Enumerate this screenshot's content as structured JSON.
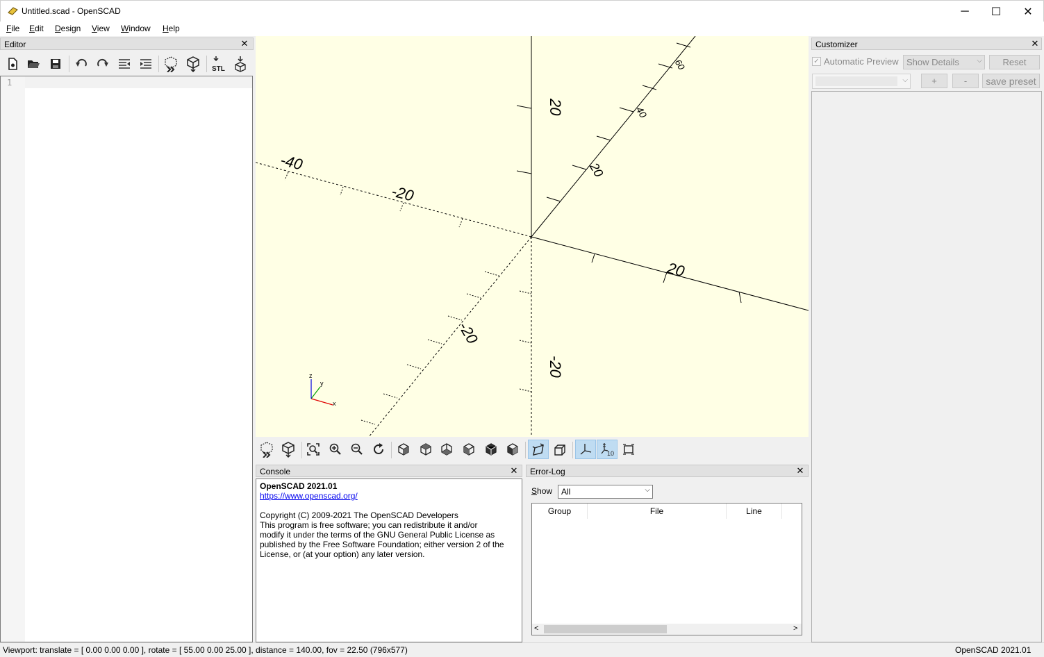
{
  "window": {
    "title": "Untitled.scad - OpenSCAD",
    "minimize": "─",
    "maximize": "☐",
    "close": "✕"
  },
  "menu": {
    "items": [
      {
        "label": "File",
        "mnemonic": "F",
        "rest": "ile"
      },
      {
        "label": "Edit",
        "mnemonic": "E",
        "rest": "dit"
      },
      {
        "label": "Design",
        "mnemonic": "D",
        "rest": "esign"
      },
      {
        "label": "View",
        "mnemonic": "V",
        "rest": "iew"
      },
      {
        "label": "Window",
        "mnemonic": "W",
        "rest": "indow"
      },
      {
        "label": "Help",
        "mnemonic": "H",
        "rest": "elp"
      }
    ]
  },
  "editor": {
    "title": "Editor",
    "close": "✕",
    "line_numbers": [
      "1"
    ],
    "toolbar_icons": [
      "new-file-icon",
      "open-file-icon",
      "save-icon",
      "undo-icon",
      "redo-icon",
      "unindent-icon",
      "indent-icon",
      "preview-icon",
      "render-icon",
      "export-stl-icon",
      "send-to-3d-print-icon"
    ],
    "stl_label": "STL"
  },
  "viewport": {
    "axis_labels": {
      "x_pos": "20",
      "x_neg": "-20",
      "x_neg2": "-40",
      "z_pos": "20",
      "z_neg": "-20",
      "y_pos1": "20",
      "y_pos2": "40",
      "y_pos3": "60",
      "y_neg": "-20"
    },
    "gizmo": {
      "x": "x",
      "y": "y",
      "z": "z"
    }
  },
  "view_toolbar": {
    "icons": [
      "preview-icon",
      "render-icon",
      "view-all-icon",
      "zoom-in-icon",
      "zoom-out-icon",
      "reset-view-icon",
      "view-right-icon",
      "view-top-icon",
      "view-bottom-icon",
      "view-left-icon",
      "view-front-icon",
      "view-back-icon",
      "perspective-icon",
      "orthogonal-icon",
      "show-axes-icon",
      "show-scale-markers-icon",
      "show-edges-icon"
    ],
    "scale_label": "10"
  },
  "console": {
    "title": "Console",
    "close": "✕",
    "version": "OpenSCAD 2021.01",
    "link": "https://www.openscad.org/",
    "copyright": "Copyright (C) 2009-2021 The OpenSCAD Developers",
    "license_lines": [
      "This program is free software; you can redistribute it and/or",
      "modify it under the terms of the GNU General Public License as",
      "published by the Free Software Foundation; either version 2 of the",
      "License, or (at your option) any later version."
    ]
  },
  "error_log": {
    "title": "Error-Log",
    "close": "✕",
    "show_label": "Show",
    "show_mnemonic": "S",
    "show_rest": "how",
    "show_value": "All",
    "columns": [
      "Group",
      "File",
      "Line"
    ]
  },
  "customizer": {
    "title": "Customizer",
    "close": "✕",
    "automatic_preview": "Automatic Preview",
    "automatic_preview_checked": true,
    "details_value": "Show Details",
    "reset": "Reset",
    "preset_value": "",
    "add": "+",
    "remove": "-",
    "save_preset": "save preset"
  },
  "status": {
    "viewport": "Viewport: translate = [ 0.00 0.00 0.00 ], rotate = [ 55.00 0.00 25.00 ], distance = 140.00, fov = 22.50 (796x577)",
    "version": "OpenSCAD 2021.01"
  },
  "colors": {
    "viewport_bg": "#ffffe5",
    "axis_x": "#e00000",
    "axis_y": "#00a000",
    "axis_z": "#0000e0",
    "link": "#0000ee"
  }
}
